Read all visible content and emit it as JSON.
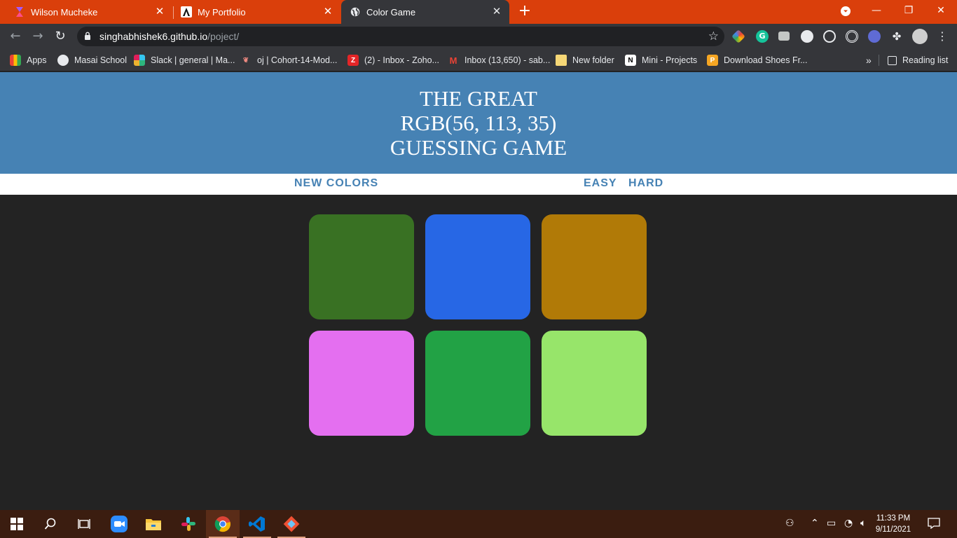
{
  "browser": {
    "tabs": [
      {
        "title": "Wilson Mucheke",
        "active": false,
        "icon": "figma-like-icon"
      },
      {
        "title": "My Portfolio",
        "active": false,
        "icon": "portfolio-a-icon"
      },
      {
        "title": "Color Game",
        "active": true,
        "icon": "globe-icon"
      }
    ],
    "url_host": "singhabhishek6.github.io",
    "url_path": "/poject/",
    "bookmarks": [
      {
        "label": "Apps",
        "icon": "apps-grid-icon"
      },
      {
        "label": "Masai School",
        "icon": "globe-icon"
      },
      {
        "label": "Slack | general | Ma...",
        "icon": "slack-icon"
      },
      {
        "label": "oj | Cohort-14-Mod...",
        "icon": "oj-icon"
      },
      {
        "label": "(2) - Inbox - Zoho...",
        "icon": "zoho-icon"
      },
      {
        "label": "Inbox (13,650) - sab...",
        "icon": "gmail-icon"
      },
      {
        "label": "New folder",
        "icon": "folder-icon"
      },
      {
        "label": "Mini - Projects",
        "icon": "notion-icon"
      },
      {
        "label": "Download Shoes Fr...",
        "icon": "download-icon"
      }
    ],
    "more_bookmarks": "»",
    "reading_list": "Reading list"
  },
  "game": {
    "title_line1": "THE GREAT",
    "title_line2": "RGB(56, 113, 35)",
    "title_line3": "GUESSING GAME",
    "new_colors_label": "NEW COLORS",
    "message": "",
    "easy_label": "EASY",
    "hard_label": "HARD",
    "squares": [
      {
        "color": "#397123"
      },
      {
        "color": "#2767e5"
      },
      {
        "color": "#b17a07"
      },
      {
        "color": "#e46ff0"
      },
      {
        "color": "#22a245"
      },
      {
        "color": "#97e56a"
      }
    ]
  },
  "taskbar": {
    "time": "11:33 PM",
    "date": "9/11/2021",
    "apps": [
      "windows-start",
      "search",
      "task-view",
      "zoom",
      "file-explorer",
      "slack",
      "chrome",
      "vscode",
      "git"
    ]
  }
}
